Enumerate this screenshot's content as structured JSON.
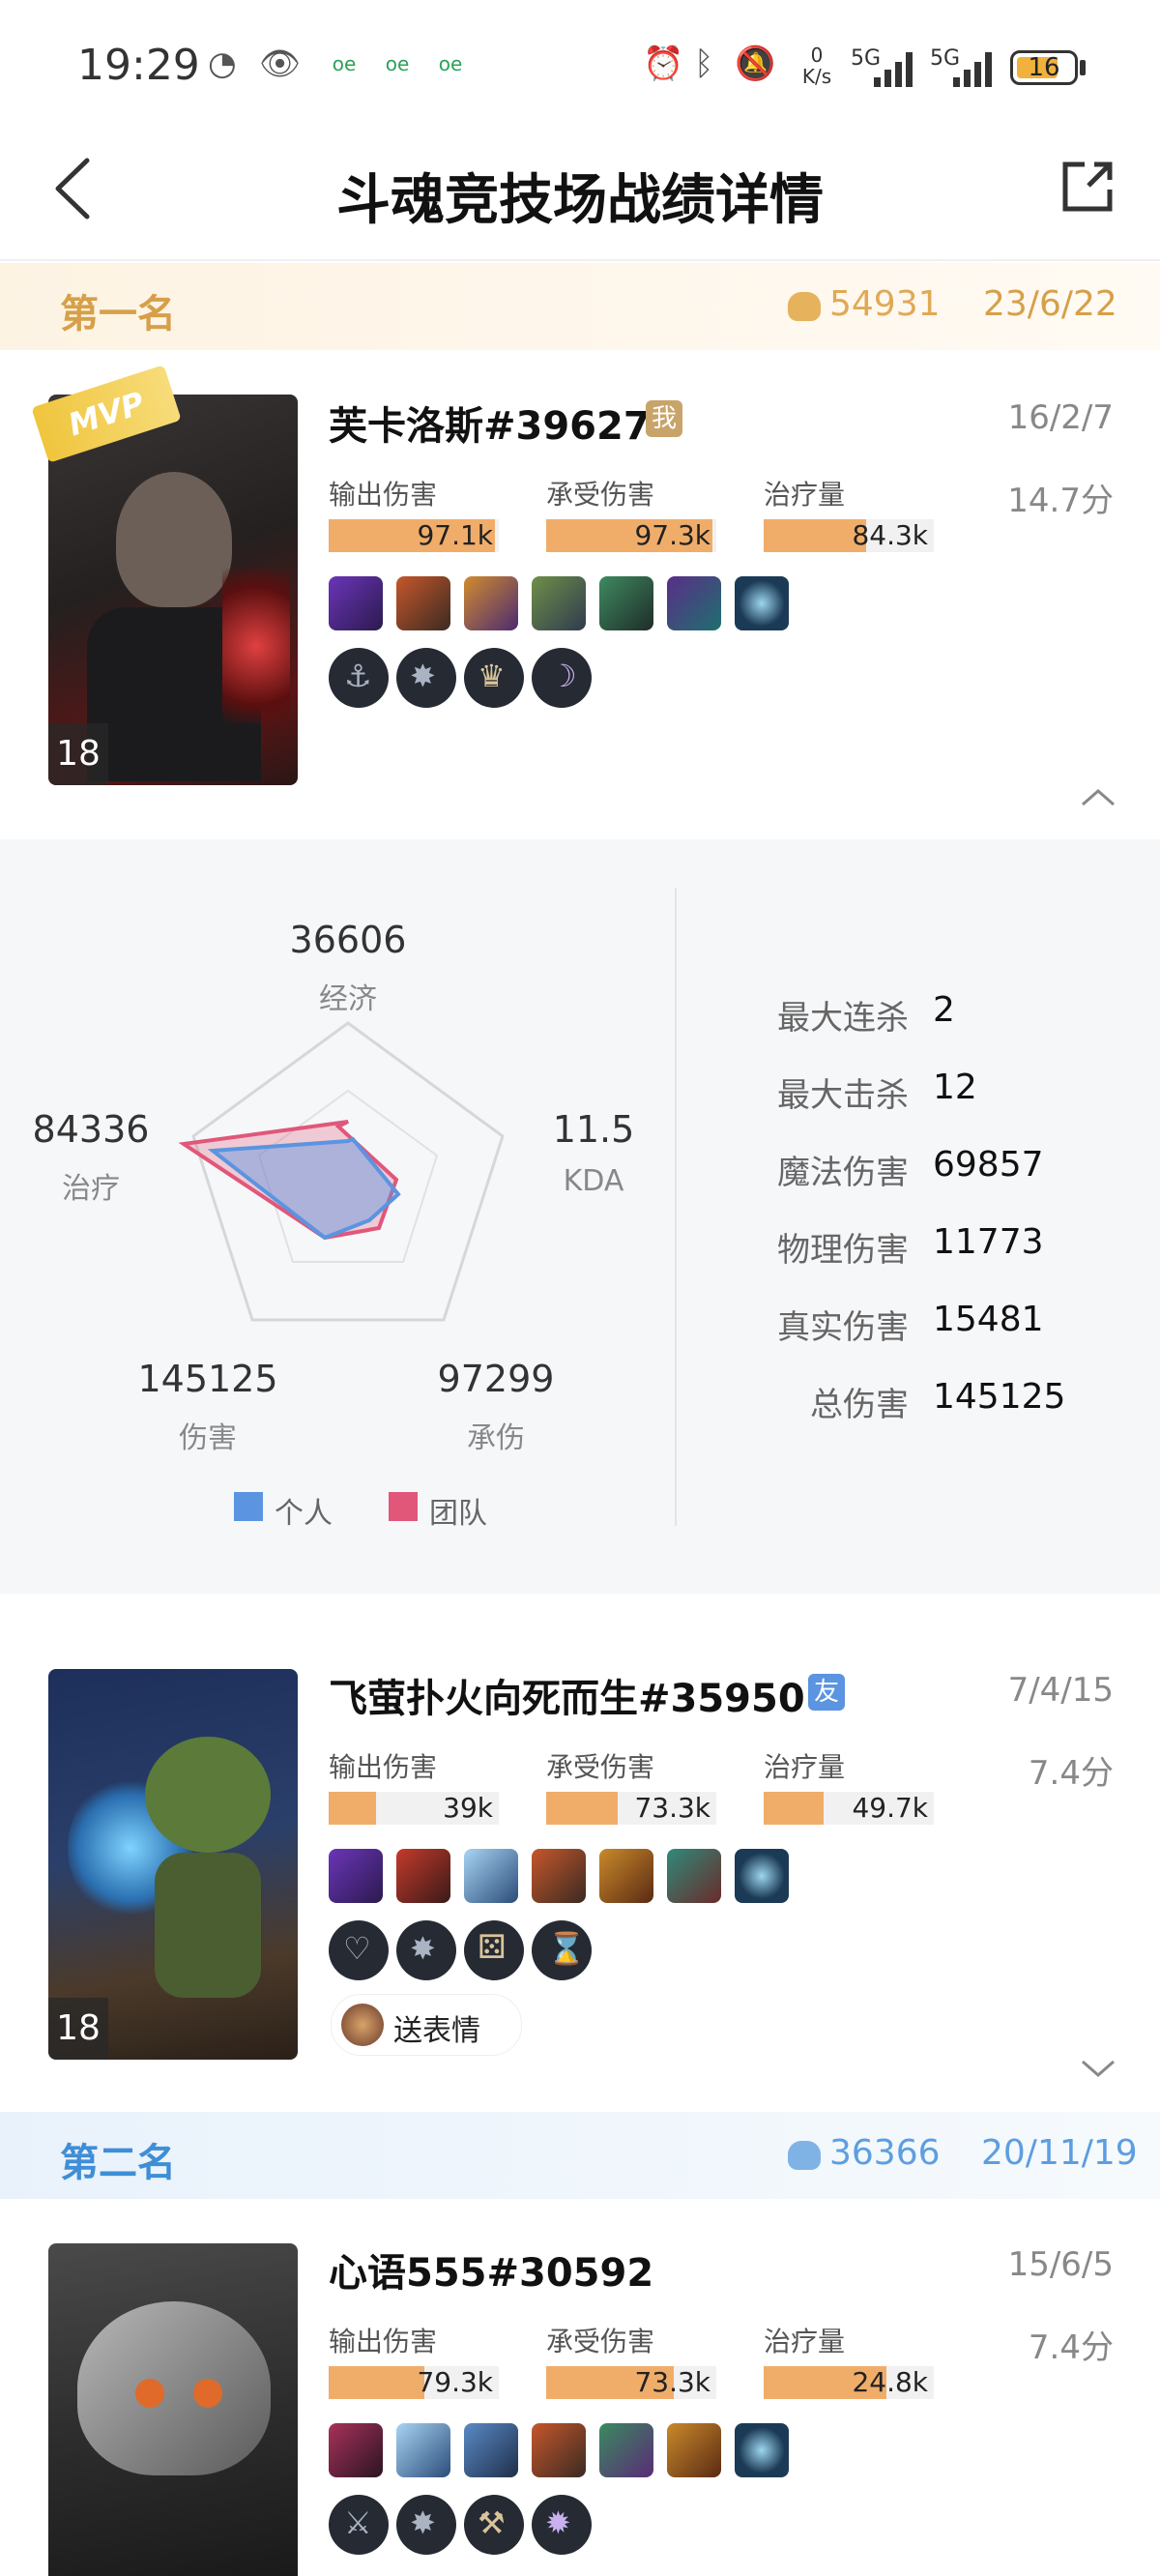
{
  "status_bar": {
    "time": "19:29",
    "badges": [
      "oe",
      "oe",
      "oe"
    ],
    "net_speed_top": "0",
    "net_speed_unit": "K/s",
    "signal1": "5G",
    "signal2": "5G",
    "battery": "16"
  },
  "header": {
    "title": "斗魂竞技场战绩详情"
  },
  "ranks": [
    {
      "label": "第一名",
      "coins": "54931",
      "date": "23/6/22"
    },
    {
      "label": "第二名",
      "coins": "36366",
      "date": "20/11/19"
    }
  ],
  "stat_labels": {
    "damage": "输出伤害",
    "taken": "承受伤害",
    "heal": "治疗量"
  },
  "players": [
    {
      "name": "芙卡洛斯#39627",
      "tag": "我",
      "kda": "16/2/7",
      "score": "14.7分",
      "level": "18",
      "mvp": "MVP",
      "damage": "97.1k",
      "damage_ratio": 0.98,
      "taken": "97.3k",
      "taken_ratio": 0.98,
      "heal": "84.3k",
      "heal_ratio": 0.6
    },
    {
      "name": "飞萤扑火向死而生#35950",
      "tag": "友",
      "kda": "7/4/15",
      "score": "7.4分",
      "level": "18",
      "damage": "39k",
      "damage_ratio": 0.28,
      "taken": "73.3k",
      "taken_ratio": 0.42,
      "heal": "49.7k",
      "heal_ratio": 0.35,
      "emote_label": "送表情"
    },
    {
      "name": "心语555#30592",
      "kda": "15/6/5",
      "score": "7.4分",
      "damage": "79.3k",
      "damage_ratio": 0.56,
      "taken": "73.3k",
      "taken_ratio": 0.75,
      "heal": "24.8k",
      "heal_ratio": 0.72
    }
  ],
  "radar": {
    "economy": {
      "value": "36606",
      "label": "经济"
    },
    "kda": {
      "value": "11.5",
      "label": "KDA"
    },
    "taken": {
      "value": "97299",
      "label": "承伤"
    },
    "damage": {
      "value": "145125",
      "label": "伤害"
    },
    "heal": {
      "value": "84336",
      "label": "治疗"
    },
    "legend": [
      {
        "name": "个人",
        "color": "#5b94e0"
      },
      {
        "name": "团队",
        "color": "#e0577a"
      }
    ]
  },
  "details": [
    {
      "label": "最大连杀",
      "value": "2"
    },
    {
      "label": "最大击杀",
      "value": "12"
    },
    {
      "label": "魔法伤害",
      "value": "69857"
    },
    {
      "label": "物理伤害",
      "value": "11773"
    },
    {
      "label": "真实伤害",
      "value": "15481"
    },
    {
      "label": "总伤害",
      "value": "145125"
    }
  ],
  "colors": {
    "gold": "#d6a049",
    "blue": "#3f8ed6",
    "bar": "#f0ad6a",
    "me_tag": "#c9a46a",
    "friend_tag": "#5b94e0"
  }
}
